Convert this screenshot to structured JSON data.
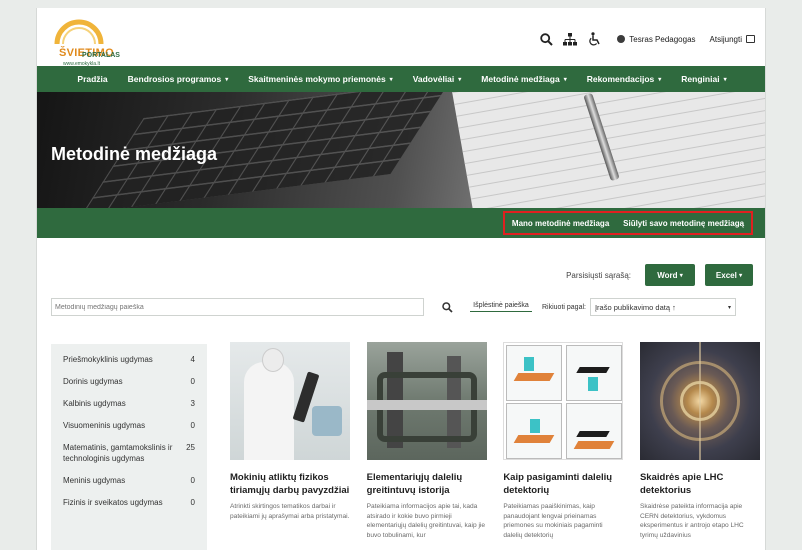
{
  "brand": {
    "line1": "ŠVIETIMO",
    "line2": "PORTALAS",
    "url": "www.emokykla.lt"
  },
  "header": {
    "user_name": "Tesras Pedagogas",
    "logout_label": "Atsijungti"
  },
  "nav": {
    "items": [
      {
        "label": "Pradžia",
        "caret": ""
      },
      {
        "label": "Bendrosios programos",
        "caret": "▾"
      },
      {
        "label": "Skaitmeninės mokymo priemonės",
        "caret": "▾"
      },
      {
        "label": "Vadovėliai",
        "caret": "▾"
      },
      {
        "label": "Metodinė medžiaga",
        "caret": "▾"
      },
      {
        "label": "Rekomendacijos",
        "caret": "▾"
      },
      {
        "label": "Renginiai",
        "caret": "▾"
      }
    ]
  },
  "hero": {
    "title": "Metodinė medžiaga"
  },
  "subnav": {
    "my_materials": "Mano metodinė medžiaga",
    "submit_material": "Siūlyti savo metodinę medžiagą"
  },
  "download": {
    "label": "Parsisiųsti sąrašą:",
    "word": "Word",
    "excel": "Excel",
    "caret": "▾"
  },
  "search": {
    "placeholder": "Metodinių medžiagų paieška",
    "advanced": "Išplėstinė paieška",
    "sort_label": "Rikiuoti pagal:",
    "sort_value": "Įrašo publikavimo datą",
    "sort_arrow": "↑"
  },
  "categories": [
    {
      "name": "Priešmokyklinis ugdymas",
      "count": "4"
    },
    {
      "name": "Dorinis ugdymas",
      "count": "0"
    },
    {
      "name": "Kalbinis ugdymas",
      "count": "3"
    },
    {
      "name": "Visuomeninis ugdymas",
      "count": "0"
    },
    {
      "name": "Matematinis, gamtamokslinis ir technologinis ugdymas",
      "count": "25"
    },
    {
      "name": "Meninis ugdymas",
      "count": "0"
    },
    {
      "name": "Fizinis ir sveikatos ugdymas",
      "count": "0"
    }
  ],
  "cards": [
    {
      "title": "Mokinių atliktų fizikos tiriamųjų darbų pavyzdžiai",
      "desc": "Atrinkti skirtingos tematikos darbai ir pateikiami jų aprašymai arba pristatymai."
    },
    {
      "title": "Elementariųjų dalelių greitintuvų istorija",
      "desc": "Pateikiama informacijos apie tai, kada atsirado ir kokie buvo pirmieji elementariųjų dalelių greitintuvai, kaip jie buvo tobulinami, kur"
    },
    {
      "title": "Kaip pasigaminti dalelių detektorių",
      "desc": "Pateikiamas paaiškinimas, kaip panaudojant lengvai prieinamas priemones su mokiniais pagaminti dalelių detektorių"
    },
    {
      "title": "Skaidrės apie LHC detektorius",
      "desc": "Skaidrėse pateikta informacija apie CERN detektorius, vykdomus eksperimentus ir antrojo etapo LHC tyrimų uždavinius"
    }
  ],
  "colors": {
    "primary_green": "#2f6a3e",
    "highlight_red": "#e02020",
    "brand_orange": "#e08a1c"
  }
}
